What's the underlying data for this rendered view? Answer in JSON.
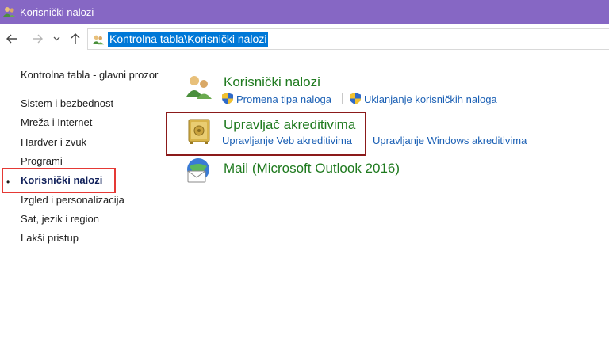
{
  "window": {
    "title": "Korisnički nalozi",
    "title_icon": "users-icon"
  },
  "nav": {
    "back_icon": "back-arrow-icon",
    "forward_icon": "forward-arrow-icon",
    "recent_icon": "chevron-down-icon",
    "up_icon": "up-arrow-icon",
    "address": "Kontrolna tabla\\Korisnički nalozi"
  },
  "sidebar": {
    "home": "Kontrolna tabla - glavni prozor",
    "items": [
      "Sistem i bezbednost",
      "Mreža i Internet",
      "Hardver i zvuk",
      "Programi",
      "Korisnički nalozi",
      "Izgled i personalizacija",
      "Sat, jezik i region",
      "Lakši pristup"
    ],
    "active_bullet": "•"
  },
  "categories": [
    {
      "title": "Korisnički nalozi",
      "icon": "users-icon",
      "links": [
        "Promena tipa naloga",
        "Uklanjanje korisničkih naloga"
      ],
      "link_icons": [
        "uac-shield-icon",
        "uac-shield-icon"
      ]
    },
    {
      "title": "Upravljač akreditivima",
      "icon": "credential-vault-icon",
      "links": [
        "Upravljanje Veb akreditivima",
        "Upravljanje Windows akreditivima"
      ]
    },
    {
      "title": "Mail (Microsoft Outlook 2016)",
      "icon": "mail-icon",
      "links": []
    }
  ],
  "colors": {
    "titlebar": "#8667c4",
    "link": "#1a5fb4",
    "category_title": "#1f7a1f",
    "address_selection": "#0078d7",
    "sidebar_highlight": "#e53935",
    "category_highlight": "#8b1a1a"
  }
}
